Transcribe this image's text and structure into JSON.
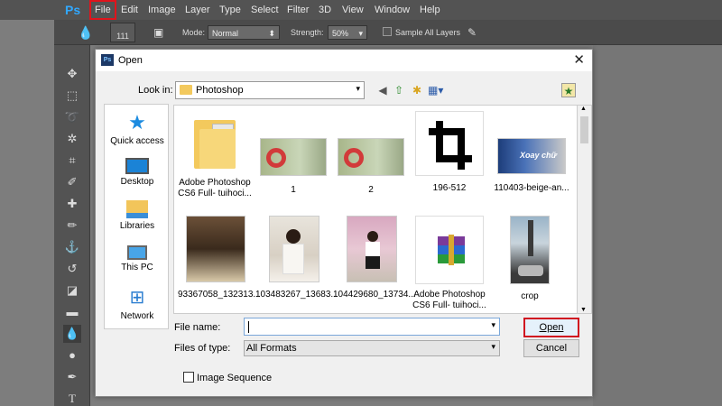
{
  "app": {
    "logo": "Ps"
  },
  "menubar": {
    "items": [
      "File",
      "Edit",
      "Image",
      "Layer",
      "Type",
      "Select",
      "Filter",
      "3D",
      "View",
      "Window",
      "Help"
    ]
  },
  "options": {
    "brush_size": "111",
    "mode_label": "Mode:",
    "mode_value": "Normal",
    "strength_label": "Strength:",
    "strength_value": "50%",
    "sample_all": "Sample All Layers"
  },
  "dialog": {
    "title": "Open",
    "look_in_label": "Look in:",
    "look_in_value": "Photoshop",
    "places": [
      {
        "label": "Quick access",
        "icon": "star-icon"
      },
      {
        "label": "Desktop",
        "icon": "desktop-icon"
      },
      {
        "label": "Libraries",
        "icon": "libraries-icon"
      },
      {
        "label": "This PC",
        "icon": "computer-icon"
      },
      {
        "label": "Network",
        "icon": "network-icon"
      }
    ],
    "files": [
      {
        "name": "Adobe Photoshop CS6 Full- tuihoci...",
        "kind": "folder"
      },
      {
        "name": "1",
        "kind": "photo"
      },
      {
        "name": "2",
        "kind": "photo"
      },
      {
        "name": "196-512",
        "kind": "crop-icon-image"
      },
      {
        "name": "110403-beige-an...",
        "kind": "photo"
      },
      {
        "name": "93367058_132313...",
        "kind": "photo"
      },
      {
        "name": "103483267_13683...",
        "kind": "photo"
      },
      {
        "name": "104429680_13734...",
        "kind": "photo"
      },
      {
        "name": "Adobe Photoshop CS6 Full- tuihoci...",
        "kind": "archive"
      },
      {
        "name": "crop",
        "kind": "photo"
      }
    ],
    "thumb_text": "Xoay chữ",
    "file_name_label": "File name:",
    "file_name_value": "",
    "files_of_type_label": "Files of type:",
    "files_of_type_value": "All Formats",
    "open_label": "Open",
    "cancel_label": "Cancel",
    "image_sequence_label": "Image Sequence"
  },
  "colors": {
    "highlight": "#e0141c",
    "menubar": "#535353",
    "ps_blue": "#31a8ff"
  }
}
